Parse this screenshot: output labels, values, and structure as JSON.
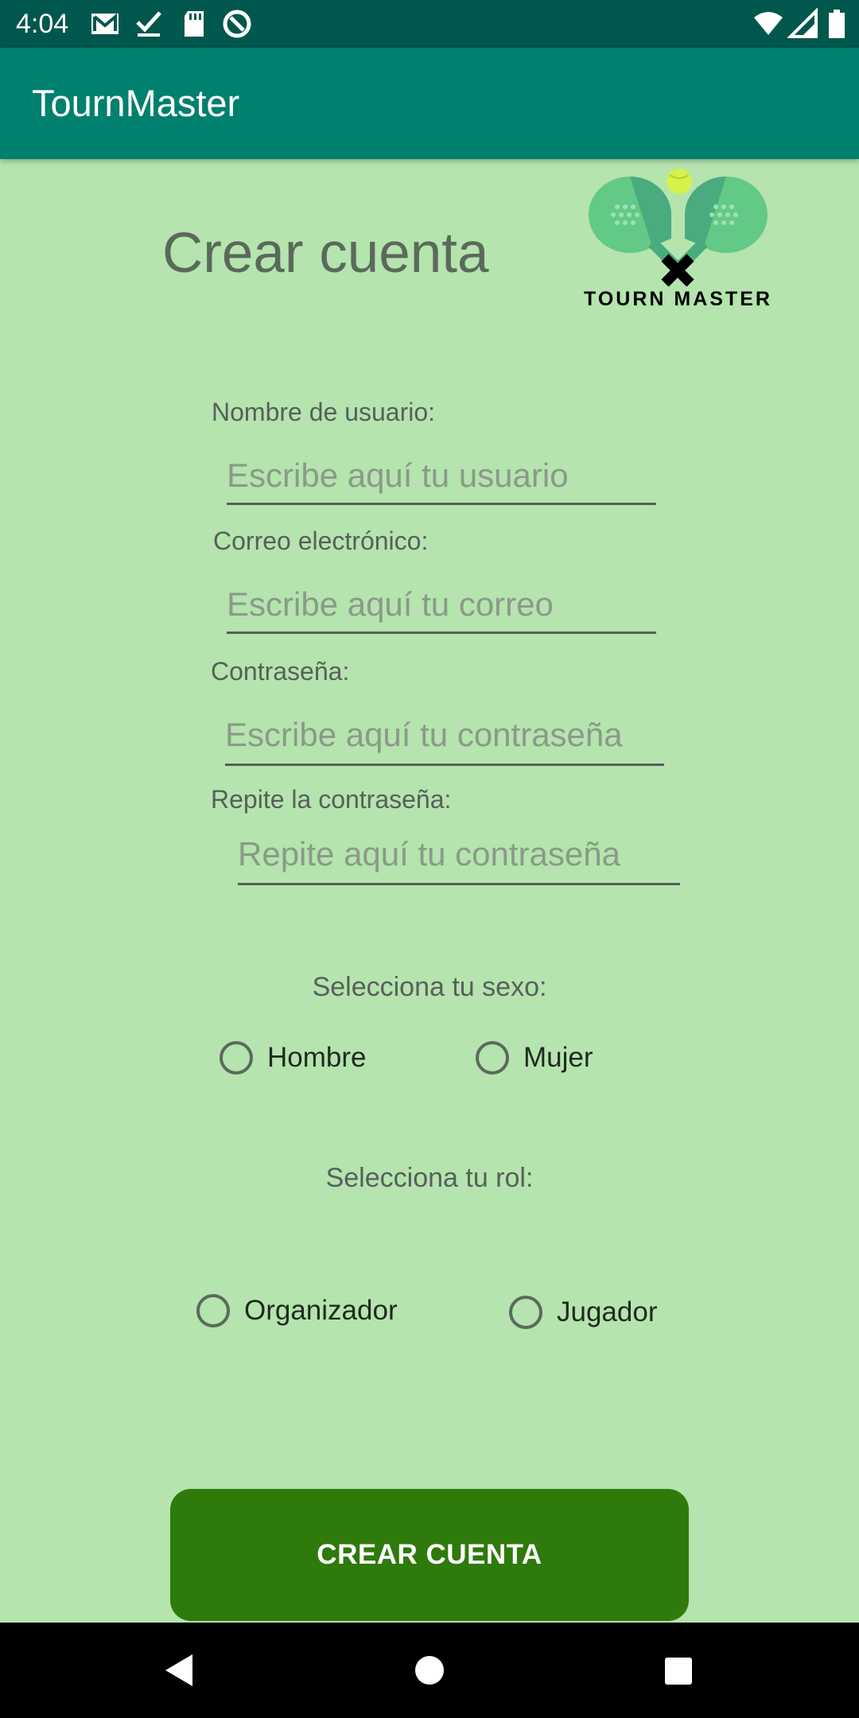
{
  "status_bar": {
    "time": "4:04",
    "icons_left": [
      "gmail-icon",
      "check-icon",
      "sd-card-icon",
      "no-disturb-icon"
    ],
    "icons_right": [
      "wifi-icon",
      "signal-icon",
      "battery-icon"
    ]
  },
  "app_bar": {
    "title": "TournMaster",
    "color": "#00806e"
  },
  "header": {
    "title": "Crear cuenta",
    "logo_text": "TOURN MASTER"
  },
  "form": {
    "username": {
      "label": "Nombre de usuario:",
      "placeholder": "Escribe aquí tu usuario"
    },
    "email": {
      "label": "Correo electrónico:",
      "placeholder": "Escribe aquí tu correo"
    },
    "password": {
      "label": "Contraseña:",
      "placeholder": "Escribe aquí tu contraseña"
    },
    "repeat_password": {
      "label": "Repite la contraseña:",
      "placeholder": "Repite aquí tu contraseña"
    }
  },
  "sex": {
    "label": "Selecciona tu sexo:",
    "options": [
      "Hombre",
      "Mujer"
    ]
  },
  "role": {
    "label": "Selecciona tu rol:",
    "options": [
      "Organizador",
      "Jugador"
    ]
  },
  "submit": {
    "label": "CREAR CUENTA",
    "color": "#2e7a0b"
  },
  "colors": {
    "background": "#b5e4ae",
    "status_bar": "#00574d"
  },
  "nav_bar": {
    "icons": [
      "back-icon",
      "home-icon",
      "recents-icon"
    ]
  }
}
